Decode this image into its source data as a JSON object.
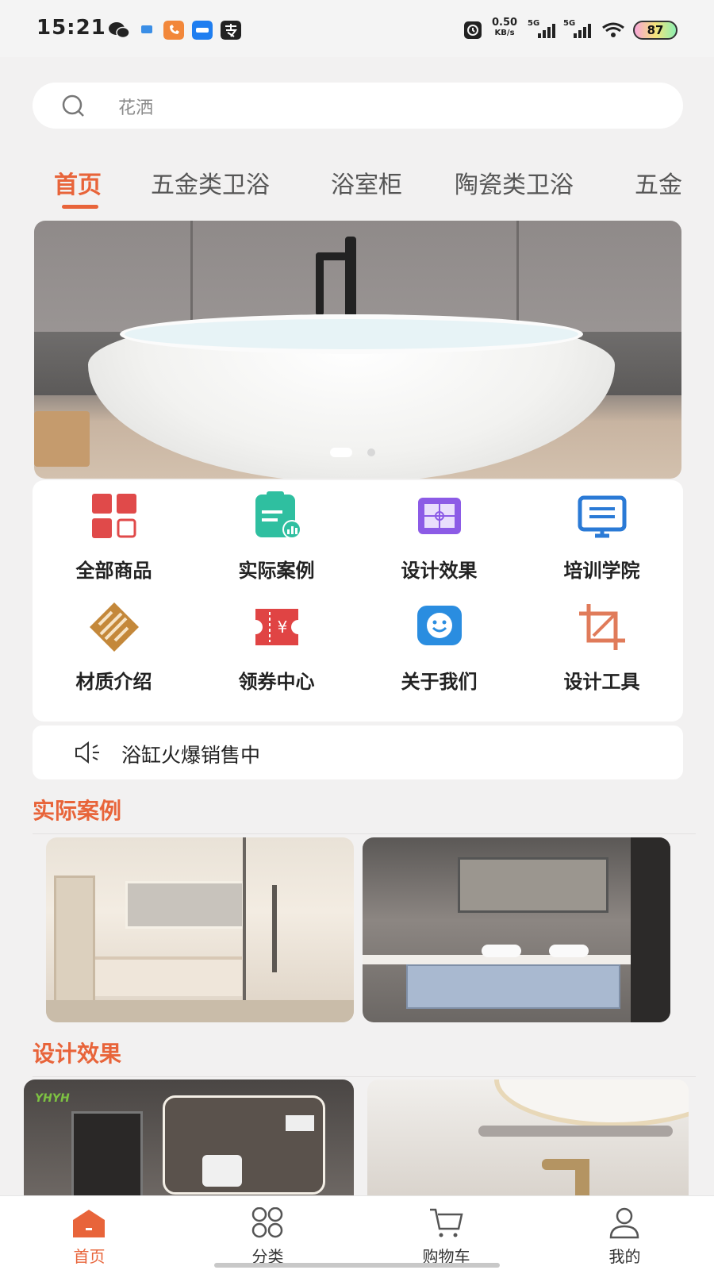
{
  "status_bar": {
    "time": "15:21",
    "net_speed_value": "0.50",
    "net_speed_unit": "KB/s",
    "signal1": "5G",
    "signal2": "5G",
    "battery": "87"
  },
  "search": {
    "placeholder": "花洒"
  },
  "tabs": [
    {
      "label": "首页",
      "active": true
    },
    {
      "label": "五金类卫浴"
    },
    {
      "label": "浴室柜"
    },
    {
      "label": "陶瓷类卫浴"
    },
    {
      "label": "五金"
    }
  ],
  "banner": {
    "active_dot": 1,
    "dot_count": 2
  },
  "grid": [
    {
      "label": "全部商品",
      "icon": "grid-icon",
      "color": "#e04a4a"
    },
    {
      "label": "实际案例",
      "icon": "project-clipboard-icon",
      "color": "#2fbfa0"
    },
    {
      "label": "设计效果",
      "icon": "blueprint-icon",
      "color": "#8c5be6"
    },
    {
      "label": "培训学院",
      "icon": "presentation-board-icon",
      "color": "#2a7ad6"
    },
    {
      "label": "材质介绍",
      "icon": "texture-icon",
      "color": "#c4883a"
    },
    {
      "label": "领券中心",
      "icon": "coupon-icon",
      "color": "#e04444"
    },
    {
      "label": "关于我们",
      "icon": "smile-chat-icon",
      "color": "#2a8de0"
    },
    {
      "label": "设计工具",
      "icon": "crop-tool-icon",
      "color": "#e07b5a"
    }
  ],
  "notice": {
    "text": "浴缸火爆销售中"
  },
  "sections": {
    "cases_title": "实际案例",
    "design_title": "设计效果"
  },
  "design_watermark": "YHYH",
  "bottom_nav": [
    {
      "label": "首页",
      "icon": "home-icon",
      "active": true
    },
    {
      "label": "分类",
      "icon": "category-icon"
    },
    {
      "label": "购物车",
      "icon": "cart-icon"
    },
    {
      "label": "我的",
      "icon": "user-icon"
    }
  ],
  "colors": {
    "accent": "#e8643a",
    "background": "#f2f1f1"
  }
}
